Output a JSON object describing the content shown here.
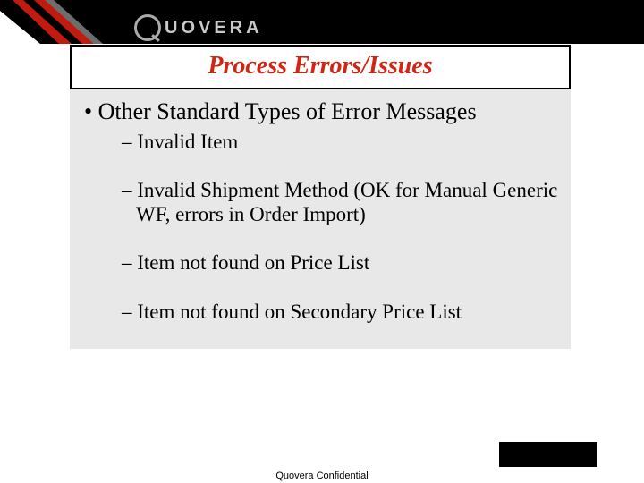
{
  "brand": {
    "logo_text": "UOVERA"
  },
  "slide": {
    "title": "Process Errors/Issues",
    "main_bullet": "Other Standard Types of Error Messages",
    "sub_bullets": [
      "Invalid Item",
      "Invalid Shipment Method (OK for Manual Generic WF, errors in Order Import)",
      "Item not found on Price  List",
      "Item not found on Secondary Price List"
    ]
  },
  "footer": {
    "text": "Quovera Confidential"
  }
}
